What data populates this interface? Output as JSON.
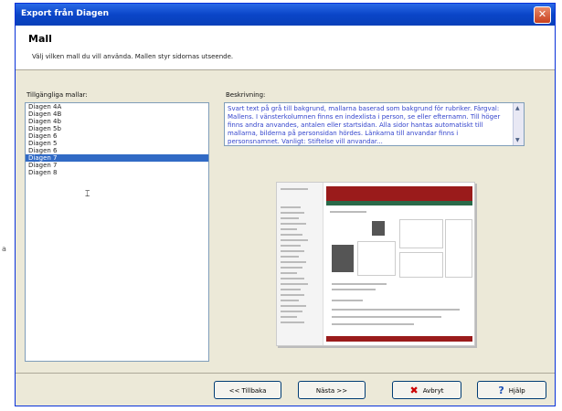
{
  "window": {
    "title": "Export från Diagen"
  },
  "header": {
    "title": "Mall",
    "subtitle": "Välj vilken mall du vill använda. Mallen styr sidornas utseende."
  },
  "background": {
    "left_char": "a"
  },
  "templates": {
    "label": "Tillgängliga mallar:",
    "items": [
      "Diagen 4A",
      "Diagen 4B",
      "Diagen 4b",
      "Diagen 5b",
      "Diagen 6",
      "Diagen 5",
      "Diagen 6",
      "Diagen 7",
      "Diagen 7",
      "Diagen 8"
    ],
    "selected_index": 7
  },
  "description": {
    "label": "Beskrivning:",
    "text": "Svart text på grå till bakgrund, mallarna baserad som bakgrund för rubriker. Färgval: Mallens. I vänsterkolumnen finns en indexlista i person, se eller efternamn. Till höger finns andra anvandes, antalen eller startsidan. Alla sidor hantas automatiskt till mallarna, bilderna på personsidan hördes. Länkarna till anvandar finns i personsnamnet. Vanligt: Stiftelse vill anvandar..."
  },
  "buttons": {
    "back": "<< Tillbaka",
    "next": "Nästa >>",
    "cancel": "Avbryt",
    "help": "Hjälp"
  },
  "colors": {
    "titlebar": "#0a45c8",
    "selection": "#316ac5",
    "cancel_icon": "#cc0000",
    "help_icon": "#1a4fb5",
    "preview_header": "#9a1b1b",
    "preview_bar": "#2a6a4a"
  }
}
